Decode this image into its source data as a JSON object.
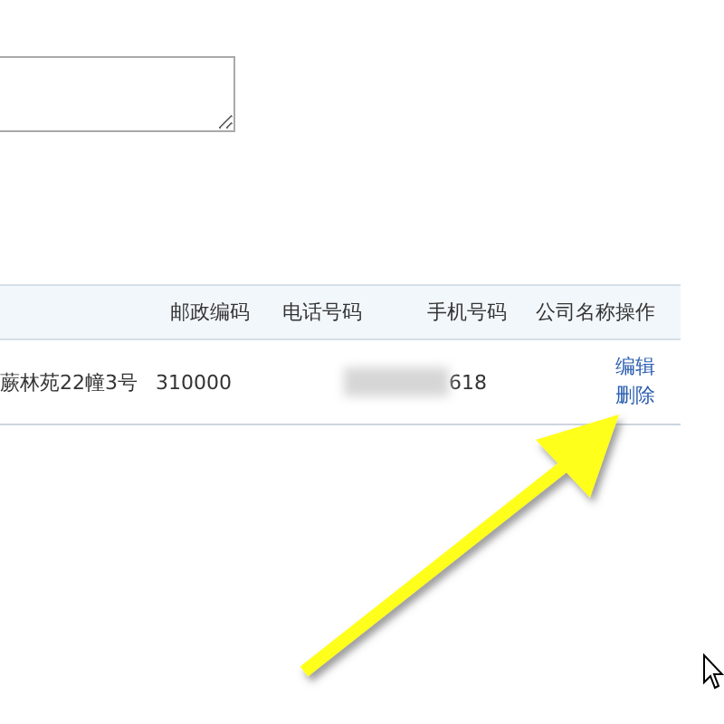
{
  "table": {
    "columns": [
      "邮政编码",
      "电话号码",
      "手机号码",
      "公司名称",
      "操作"
    ],
    "rows": [
      {
        "address": "蕨林苑22幢3号",
        "postal_code": "310000",
        "mobile": "618",
        "actions": [
          "编辑",
          "删除"
        ]
      }
    ]
  }
}
